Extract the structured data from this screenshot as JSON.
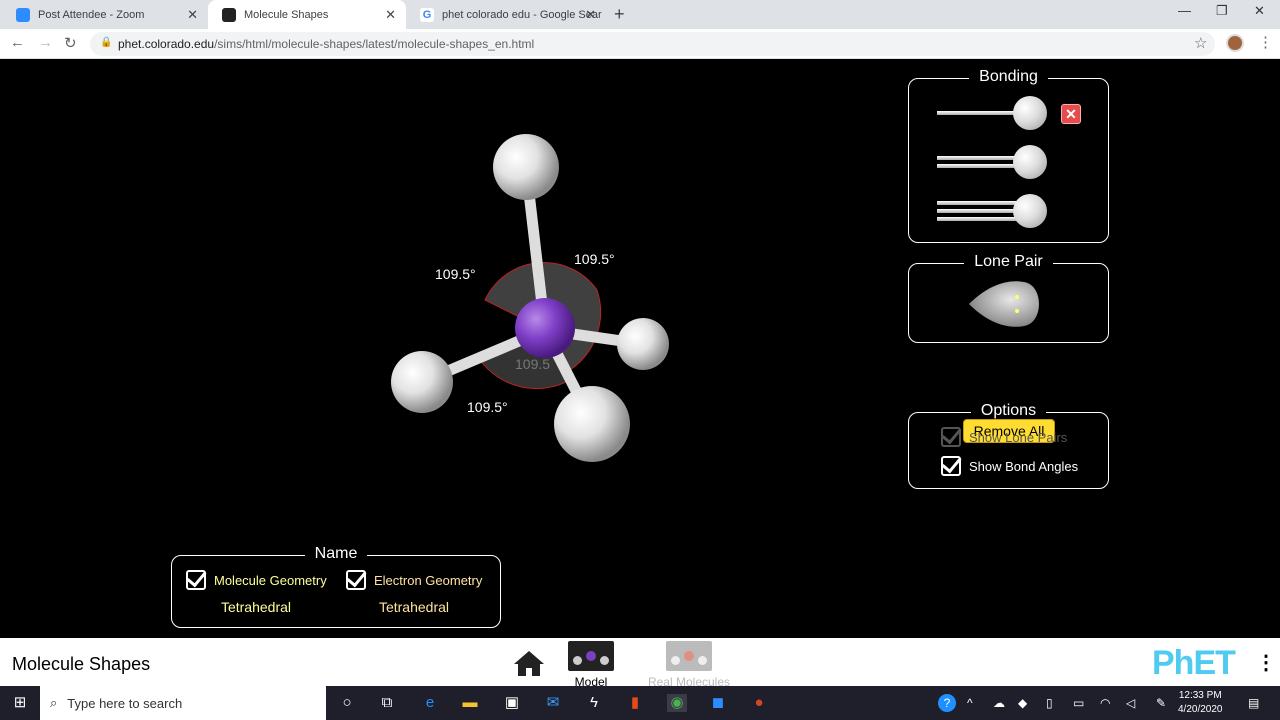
{
  "browser": {
    "tabs": [
      {
        "title": "Post Attendee - Zoom",
        "active": false
      },
      {
        "title": "Molecule Shapes",
        "active": true
      },
      {
        "title": "phet colorado edu - Google Sear",
        "active": false
      }
    ],
    "url_domain": "phet.colorado.edu",
    "url_path": "/sims/html/molecule-shapes/latest/molecule-shapes_en.html"
  },
  "sim": {
    "bonding": {
      "title": "Bonding"
    },
    "lone_pair": {
      "title": "Lone Pair"
    },
    "remove_all_label": "Remove All",
    "options": {
      "title": "Options",
      "show_lone_pairs": "Show Lone Pairs",
      "show_bond_angles": "Show Bond Angles"
    },
    "name_panel": {
      "title": "Name",
      "molecule_geometry_label": "Molecule Geometry",
      "electron_geometry_label": "Electron Geometry",
      "molecule_geometry_value": "Tetrahedral",
      "electron_geometry_value": "Tetrahedral"
    },
    "angles": [
      "109.5°",
      "109.5°",
      "109.5°",
      "109.5"
    ]
  },
  "navbar": {
    "title": "Molecule Shapes",
    "screens": [
      {
        "label": "Model",
        "active": true
      },
      {
        "label": "Real Molecules",
        "active": false
      }
    ],
    "brand": "PhET"
  },
  "taskbar": {
    "search_placeholder": "Type here to search",
    "time": "12:33 PM",
    "date": "4/20/2020"
  },
  "colors": {
    "central_atom": "#7b3fbf",
    "remove_button": "#fedc32",
    "accent_yellow": "#ffff99"
  }
}
